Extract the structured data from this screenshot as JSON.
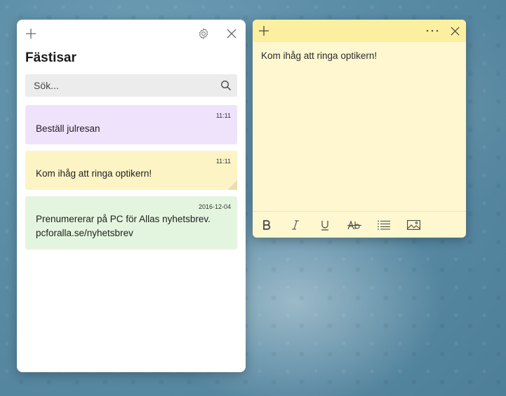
{
  "list_window": {
    "title": "Fästisar",
    "search": {
      "placeholder": "Sök...",
      "value": ""
    },
    "notes": [
      {
        "time": "11:11",
        "line1": "Beställ julresan",
        "line2": "",
        "color": "#efe2fb"
      },
      {
        "time": "11:11",
        "line1": "Kom ihåg att ringa optikern!",
        "line2": "",
        "color": "#fdf4c6"
      },
      {
        "time": "2016-12-04",
        "line1": "Prenumererar på PC för Allas nyhetsbrev.",
        "line2": "pcforalla.se/nyhetsbrev",
        "color": "#e3f5df"
      }
    ]
  },
  "note_window": {
    "content": "Kom ihåg att ringa optikern!",
    "header_color": "#fdefa0",
    "body_color": "#fff7cf"
  },
  "icons": {
    "add": "plus-icon",
    "settings": "gear-icon",
    "close": "close-icon",
    "more": "more-icon",
    "search": "search-icon",
    "bold": "bold-icon",
    "italic": "italic-icon",
    "underline": "underline-icon",
    "strikethrough": "strikethrough-icon",
    "list": "bullet-list-icon",
    "image": "image-icon"
  }
}
